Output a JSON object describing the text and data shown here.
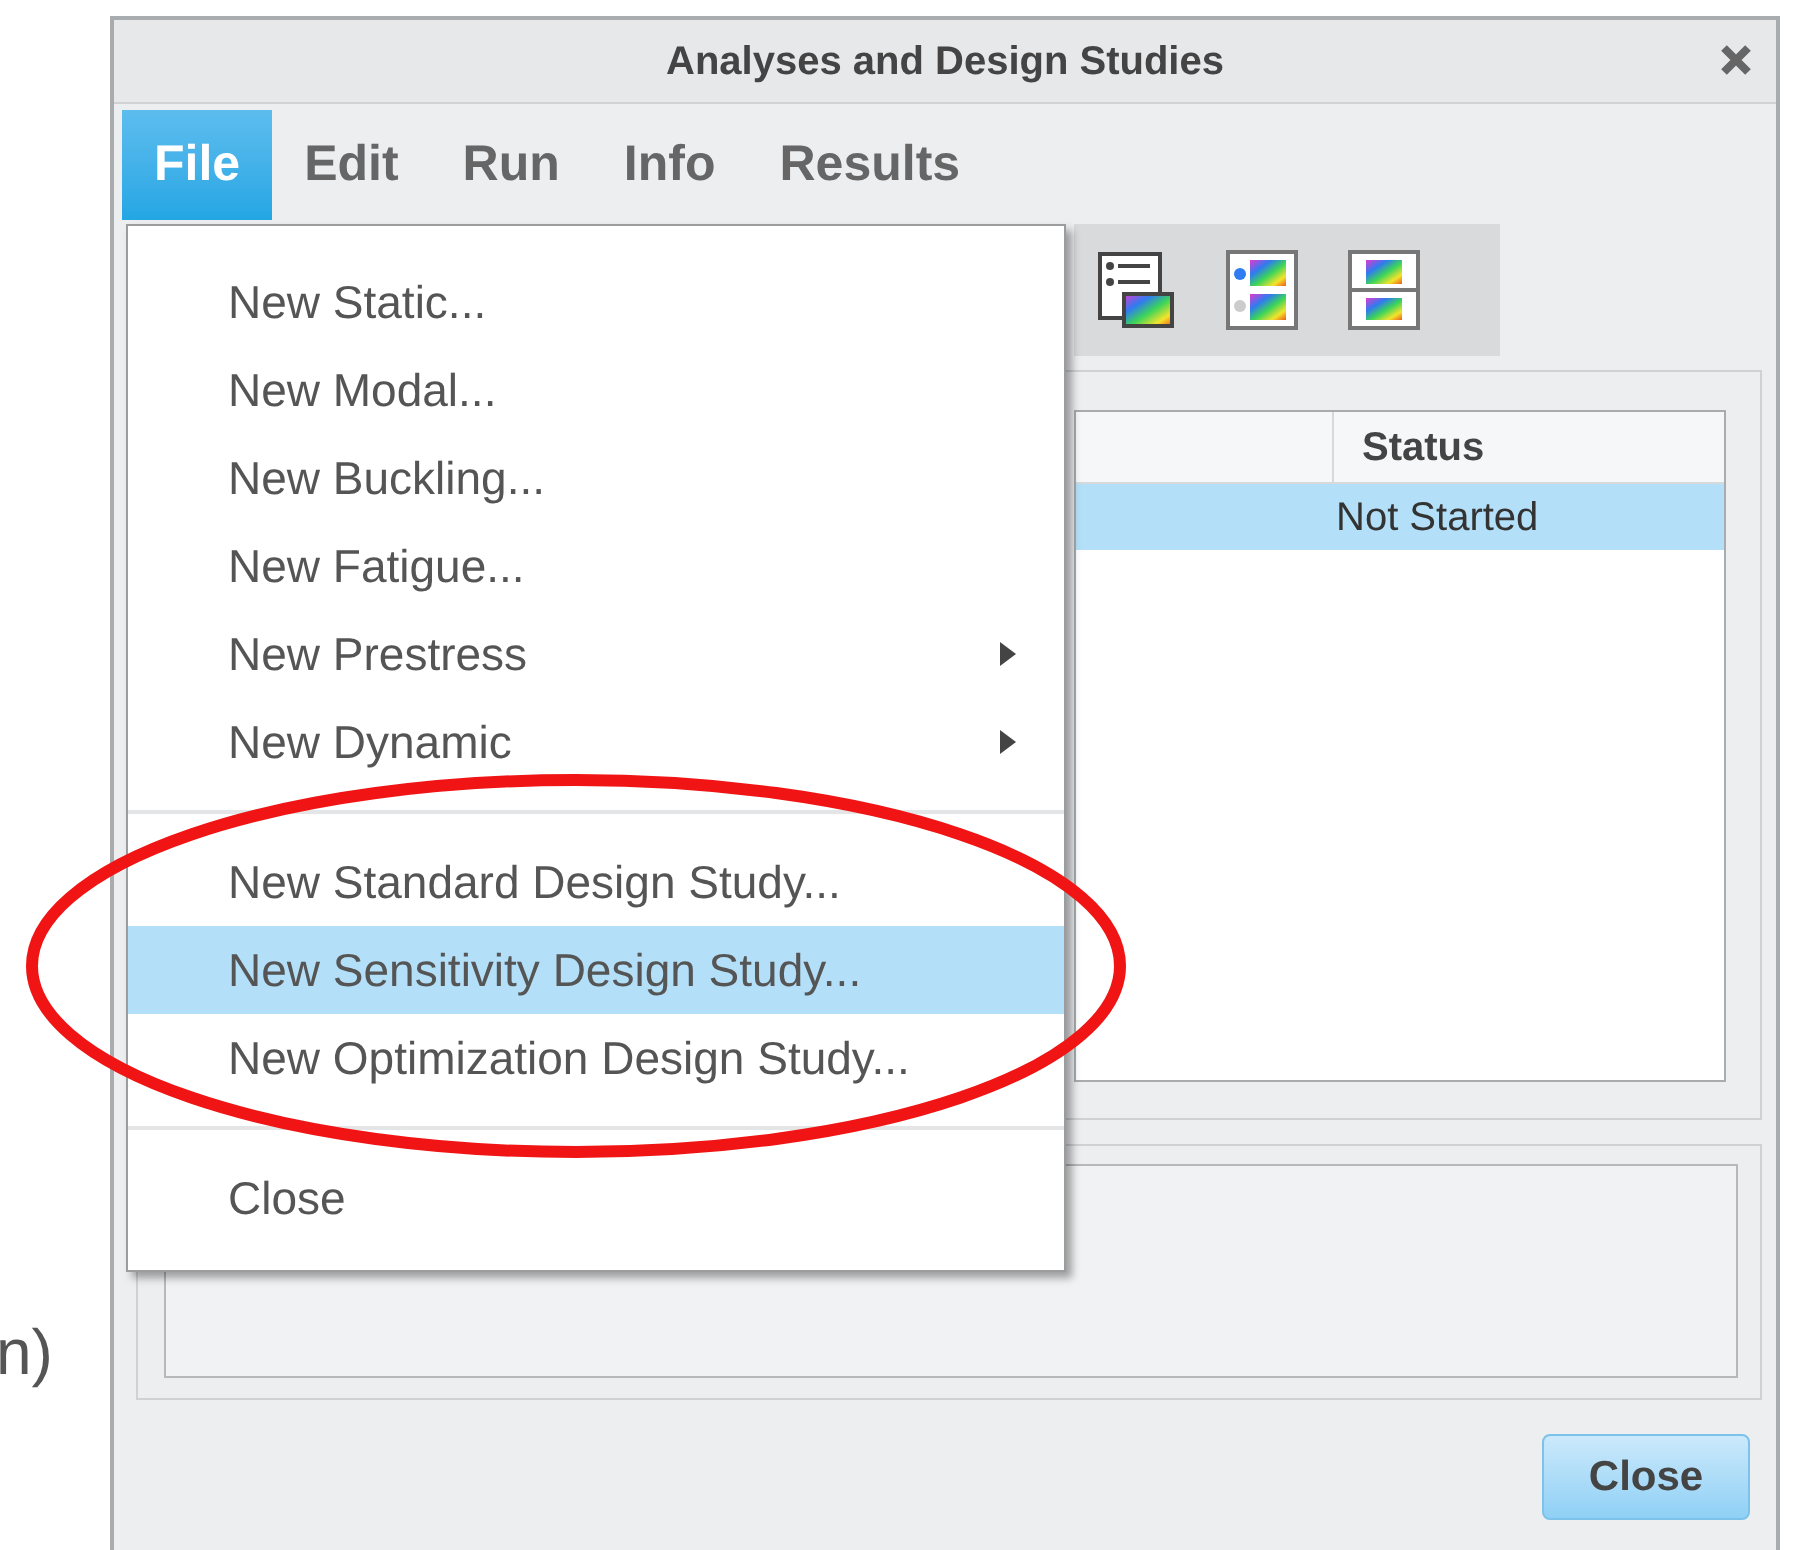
{
  "side_text": "n)",
  "window": {
    "title": "Analyses and Design Studies"
  },
  "menu_bar": [
    {
      "label": "File",
      "selected": true
    },
    {
      "label": "Edit",
      "selected": false
    },
    {
      "label": "Run",
      "selected": false
    },
    {
      "label": "Info",
      "selected": false
    },
    {
      "label": "Results",
      "selected": false
    }
  ],
  "file_menu": [
    {
      "kind": "item",
      "label": "New Static...",
      "selected": false
    },
    {
      "kind": "item",
      "label": "New Modal...",
      "selected": false
    },
    {
      "kind": "item",
      "label": "New Buckling...",
      "selected": false
    },
    {
      "kind": "item",
      "label": "New Fatigue...",
      "selected": false
    },
    {
      "kind": "submenu",
      "label": "New Prestress",
      "selected": false
    },
    {
      "kind": "submenu",
      "label": "New Dynamic",
      "selected": false
    },
    {
      "kind": "separator"
    },
    {
      "kind": "item",
      "label": "New Standard Design Study...",
      "selected": false
    },
    {
      "kind": "item",
      "label": "New Sensitivity Design Study...",
      "selected": true
    },
    {
      "kind": "item",
      "label": "New Optimization Design Study...",
      "selected": false
    },
    {
      "kind": "separator"
    },
    {
      "kind": "item",
      "label": "Close",
      "selected": false
    }
  ],
  "table": {
    "columns": [
      "Status"
    ],
    "rows": [
      {
        "status": "Not Started",
        "selected": true
      }
    ]
  },
  "buttons": [
    "Close"
  ],
  "annotation": {
    "kind": "ellipse"
  }
}
